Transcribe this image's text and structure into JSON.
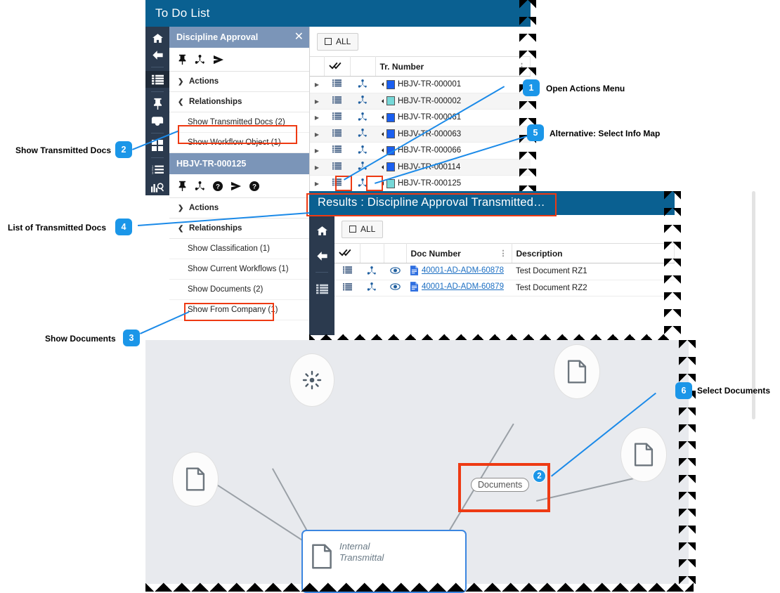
{
  "window1": {
    "title": "To Do List",
    "rail_icons": [
      "home-icon",
      "back-arrow-icon",
      "list-icon",
      "pin-icon",
      "inbox-icon",
      "grid-icon",
      "numbered-list-icon",
      "chart-search-icon"
    ],
    "detail": {
      "title": "Discipline Approval",
      "close": "✕",
      "tool_icons": [
        "pin-icon",
        "info-map-icon",
        "send-icon"
      ],
      "actions_label": "Actions",
      "relationships_label": "Relationships",
      "relationships": [
        {
          "label": "Show Transmitted Docs (2)",
          "highlighted": true
        },
        {
          "label": "Show Workflow Object (1)",
          "highlighted": false
        }
      ]
    },
    "detail2": {
      "title": "HBJV-TR-000125",
      "tool_icons": [
        "pin-icon",
        "info-map-icon",
        "help-icon",
        "send-icon",
        "help-icon"
      ],
      "actions_label": "Actions",
      "relationships_label": "Relationships",
      "relationships": [
        {
          "label": "Show Classification (1)",
          "highlighted": false
        },
        {
          "label": "Show Current Workflows (1)",
          "highlighted": false
        },
        {
          "label": "Show Documents (2)",
          "highlighted": true
        },
        {
          "label": "Show From Company (1)",
          "highlighted": false
        }
      ]
    },
    "grid": {
      "all_button": "ALL",
      "columns": [
        "",
        "check-all-icon",
        "",
        "Tr. Number"
      ],
      "column_header": "Tr. Number",
      "rows": [
        {
          "number": "HBJV-TR-000001",
          "swatch": "#1a5ff0"
        },
        {
          "number": "HBJV-TR-000002",
          "swatch": "#76d8d8"
        },
        {
          "number": "HBJV-TR-000061",
          "swatch": "#1a5ff0"
        },
        {
          "number": "HBJV-TR-000063",
          "swatch": "#1a5ff0"
        },
        {
          "number": "HBJV-TR-000066",
          "swatch": "#1a5ff0"
        },
        {
          "number": "HBJV-TR-000114",
          "swatch": "#1a5ff0"
        },
        {
          "number": "HBJV-TR-000125",
          "swatch": "#76d8d8"
        }
      ]
    }
  },
  "window2": {
    "title": "Results : Discipline Approval Transmitted…",
    "rail_icons": [
      "home-icon",
      "back-arrow-icon",
      "list-icon"
    ],
    "grid": {
      "all_button": "ALL",
      "columns": [
        "check-all-icon",
        "Doc Number",
        "Description"
      ],
      "col_doc": "Doc Number",
      "col_desc": "Description",
      "rows": [
        {
          "doc": "40001-AD-ADM-60878",
          "desc": "Test Document RZ1"
        },
        {
          "doc": "40001-AD-ADM-60879",
          "desc": "Test Document RZ2"
        }
      ]
    }
  },
  "window3": {
    "nodes": [
      {
        "name": "gear-node",
        "icon": "asterisk-icon"
      },
      {
        "name": "doc-node-top",
        "icon": "document-icon"
      },
      {
        "name": "doc-node-left",
        "icon": "document-icon"
      },
      {
        "name": "doc-node-right",
        "icon": "document-icon"
      }
    ],
    "edge_label": "Documents",
    "edge_badge": "2",
    "selected_node": {
      "label_line1": "Internal",
      "label_line2": "Transmittal",
      "icon": "document-icon"
    }
  },
  "callouts": [
    {
      "num": "1",
      "text": "Open Actions Menu"
    },
    {
      "num": "2",
      "text": "Show Transmitted Docs"
    },
    {
      "num": "3",
      "text": "Show Documents"
    },
    {
      "num": "4",
      "text": "List of Transmitted Docs"
    },
    {
      "num": "5",
      "text": "Alternative: Select Info Map"
    },
    {
      "num": "6",
      "text": "Select Documents"
    }
  ],
  "colors": {
    "header_blue": "#0a6091",
    "panel_blue": "#7b95b8",
    "rail_dark": "#2b3a4e",
    "accent_blue": "#1b96e8",
    "highlight_red": "#ee3a13",
    "map_bg": "#e8eaee"
  }
}
